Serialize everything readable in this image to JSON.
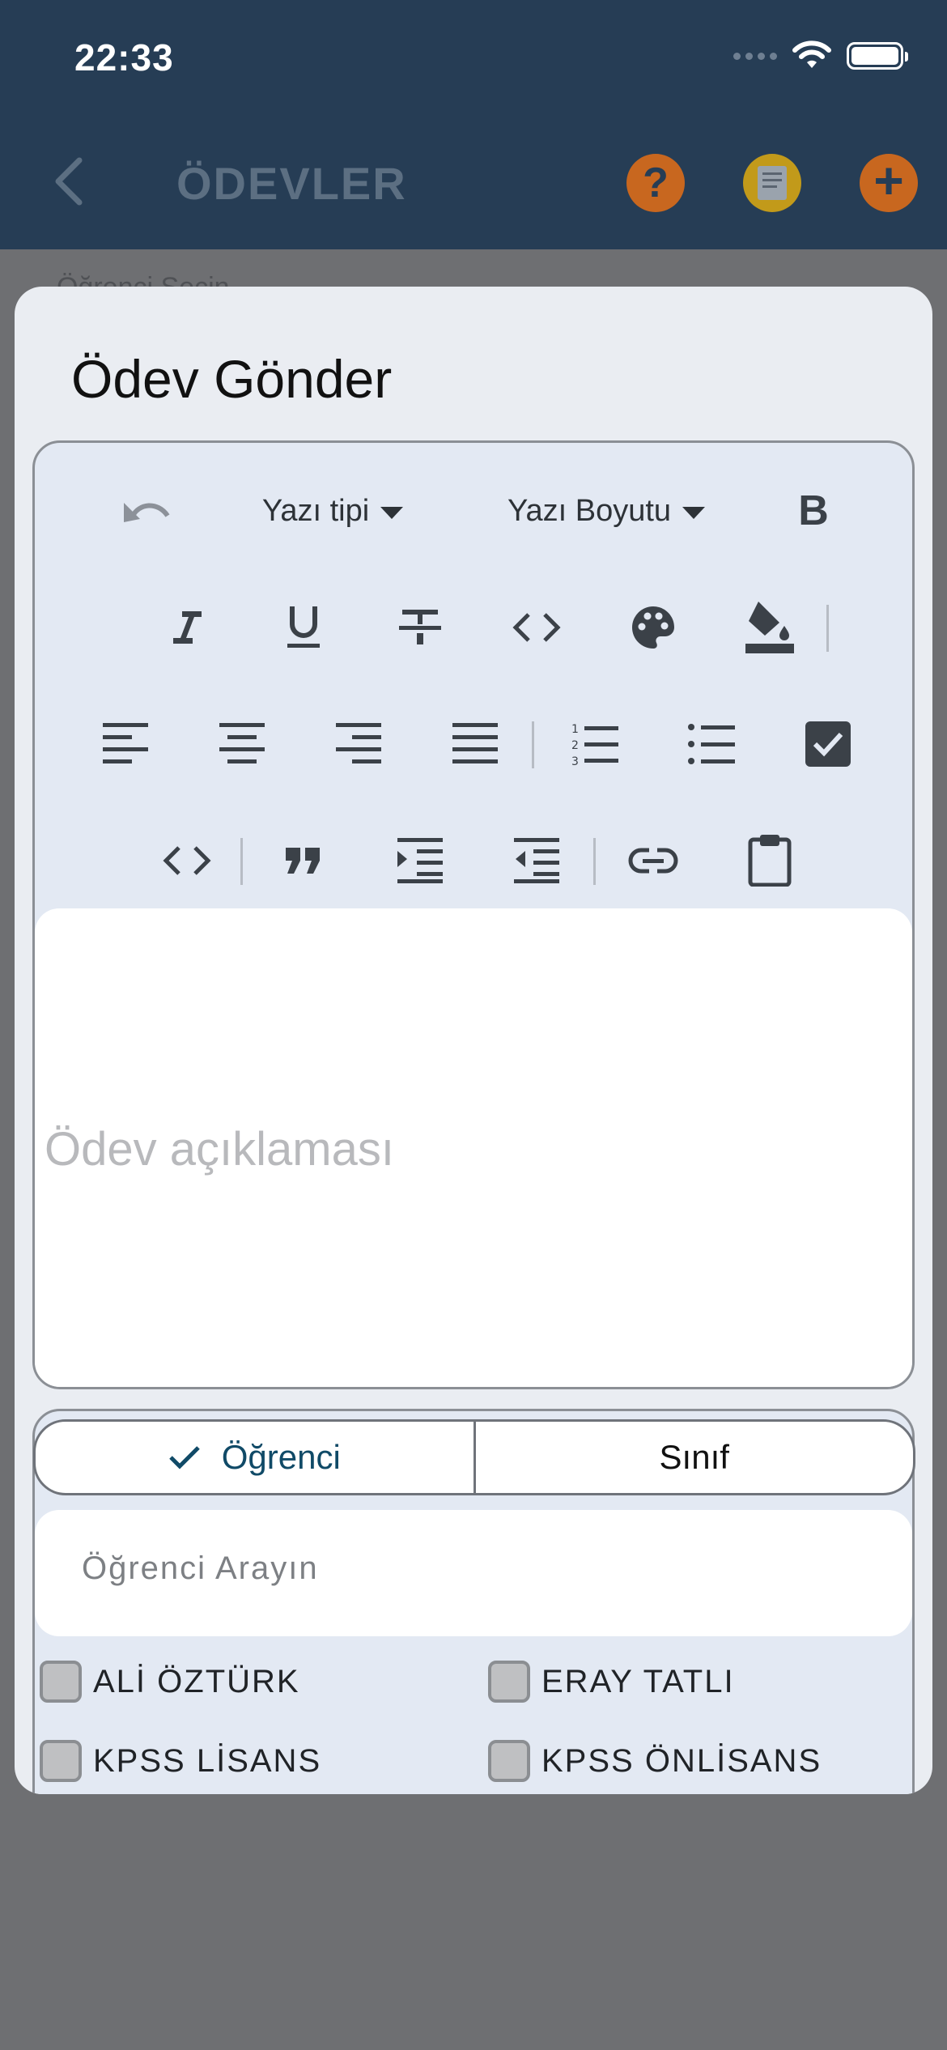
{
  "status": {
    "time": "22:33"
  },
  "header": {
    "title": "ÖDEVLER",
    "help_icon": "?",
    "add_icon": "+"
  },
  "background": {
    "partial_text": "Öğrenci Seçin"
  },
  "modal": {
    "title": "Ödev Gönder",
    "toolbar": {
      "font_dropdown": "Yazı tipi",
      "size_dropdown": "Yazı Boyutu",
      "bold_label": "B"
    },
    "editor": {
      "placeholder": "Ödev açıklaması"
    },
    "target_tabs": {
      "student": "Öğrenci",
      "class": "Sınıf",
      "selected": "Öğrenci"
    },
    "search": {
      "placeholder": "Öğrenci Arayın"
    },
    "options": [
      {
        "label": "ALİ ÖZTÜRK",
        "checked": false
      },
      {
        "label": "ERAY TATLI",
        "checked": false
      },
      {
        "label": "KPSS LİSANS",
        "checked": false
      },
      {
        "label": "KPSS ÖNLİSANS",
        "checked": false
      }
    ]
  },
  "colors": {
    "header_bg": "#263d55",
    "accent_orange": "#c8671f",
    "accent_yellow": "#c29a1a",
    "selected_tab": "#104a67"
  }
}
